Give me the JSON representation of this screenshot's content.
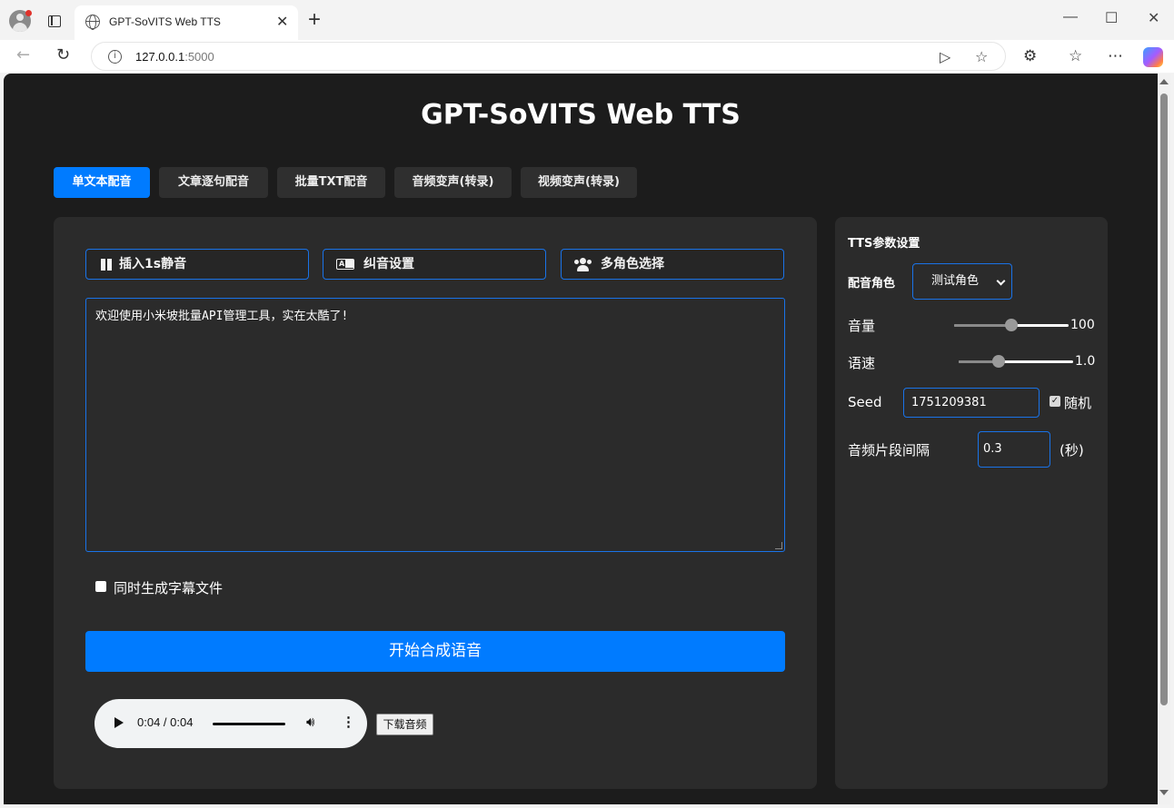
{
  "browser": {
    "tab_title": "GPT-SoVITS Web TTS",
    "tab_close": "✕",
    "new_tab": "+",
    "url_host": "127.0.0.1",
    "url_port": ":5000",
    "window_controls": [
      "—",
      "☐",
      "✕"
    ]
  },
  "page": {
    "title": "GPT-SoVITS Web TTS",
    "tabs": [
      {
        "label": "单文本配音",
        "active": true
      },
      {
        "label": "文章逐句配音",
        "active": false
      },
      {
        "label": "批量TXT配音",
        "active": false
      },
      {
        "label": "音频变声(转录)",
        "active": false
      },
      {
        "label": "视频变声(转录)",
        "active": false
      }
    ]
  },
  "editor": {
    "insert_silence": "插入1s静音",
    "pronunciation": "纠音设置",
    "multi_role": "多角色选择",
    "text": "欢迎使用小米坡批量API管理工具，实在太酷了!",
    "subtitle_label": "同时生成字幕文件",
    "subtitle_checked": false,
    "synthesize": "开始合成语音",
    "audio_time": "0:04 / 0:04",
    "download": "下载音频"
  },
  "params": {
    "title": "TTS参数设置",
    "role_label": "配音角色",
    "role_value": "测试角色",
    "volume_label": "音量",
    "volume_value": "100",
    "volume_fraction": 0.5,
    "speed_label": "语速",
    "speed_value": "1.0",
    "speed_fraction": 0.35,
    "seed_label": "Seed",
    "seed_value": "1751209381",
    "random_label": "随机",
    "random_checked": true,
    "gap_label": "音频片段间隔",
    "gap_value": "0.3",
    "gap_unit": "(秒)"
  },
  "colors": {
    "accent": "#007bff",
    "background": "#1c1c1c",
    "panel": "#2b2b2b",
    "border_accent": "#1a73e8"
  }
}
